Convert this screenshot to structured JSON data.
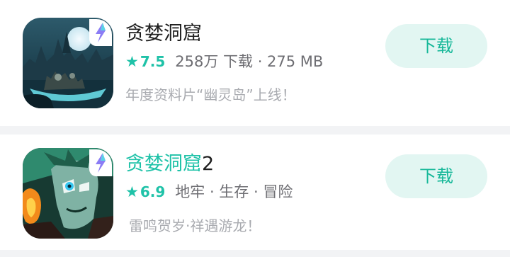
{
  "apps": [
    {
      "icon": "dark-dungeon-boat-game-icon",
      "badge_icon": "lightning-bolt-icon",
      "title": "贪婪洞窟",
      "title_suffix": "",
      "rating_star": "★",
      "rating": "7.5",
      "meta": "258万 下载 · 275 MB",
      "description": "年度资料片“幽灵岛”上线！",
      "download_label": "下载"
    },
    {
      "icon": "hero-character-torch-game-icon",
      "badge_icon": "lightning-bolt-icon",
      "title": "贪婪洞窟",
      "title_suffix": "2",
      "rating_star": "★",
      "rating": "6.9",
      "meta": "地牢 · 生存 · 冒险",
      "description": "雷鸣贺岁·祥遇游龙！",
      "download_label": "下载"
    }
  ],
  "colors": {
    "accent": "#1fc2a8",
    "button_bg": "#e2f6f2",
    "button_text": "#17b899",
    "separator": "#f2f3f5"
  }
}
